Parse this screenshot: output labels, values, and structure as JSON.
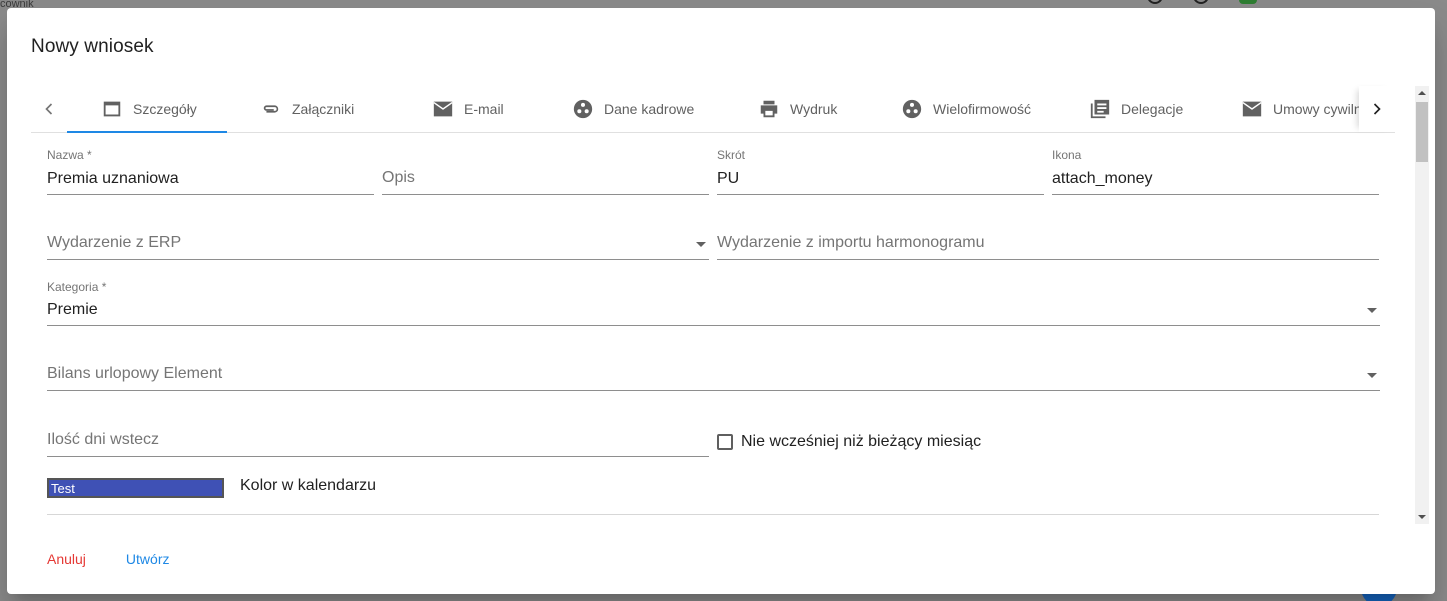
{
  "background": {
    "partial_text": "cownik"
  },
  "dialog": {
    "title": "Nowy wniosek",
    "tabs": [
      {
        "label": "Szczegóły",
        "icon": "calendar-tab-icon",
        "active": true
      },
      {
        "label": "Załączniki",
        "icon": "paperclip-icon"
      },
      {
        "label": "E-mail",
        "icon": "envelope-icon"
      },
      {
        "label": "Dane kadrowe",
        "icon": "hub-icon"
      },
      {
        "label": "Wydruk",
        "icon": "printer-icon"
      },
      {
        "label": "Wielofirmowość",
        "icon": "hub-icon"
      },
      {
        "label": "Delegacje",
        "icon": "library-books-icon"
      },
      {
        "label": "Umowy cywilnoprawne",
        "icon": "envelope-icon"
      }
    ],
    "form": {
      "nazwa": {
        "label": "Nazwa *",
        "value": "Premia uznaniowa"
      },
      "opis": {
        "placeholder": "Opis"
      },
      "skrot": {
        "label": "Skrót",
        "value": "PU"
      },
      "ikona": {
        "label": "Ikona",
        "value": "attach_money"
      },
      "wydarzenie_erp": {
        "placeholder": "Wydarzenie z ERP"
      },
      "wydarzenie_import": {
        "placeholder": "Wydarzenie z importu harmonogramu"
      },
      "kategoria": {
        "label": "Kategoria *",
        "value": "Premie"
      },
      "bilans": {
        "placeholder": "Bilans urlopowy Element"
      },
      "ilosc_dni": {
        "placeholder": "Ilość dni wstecz"
      },
      "checkbox_label": "Nie wcześniej niż bieżący miesiąc",
      "checkbox_checked": false,
      "color_sample_text": "Test",
      "color_sample_color": "#3f51b5",
      "color_label": "Kolor w kalendarzu"
    },
    "actions": {
      "cancel": "Anuluj",
      "create": "Utwórz"
    }
  },
  "colors": {
    "accent": "#1e88e5",
    "danger": "#e53935"
  }
}
